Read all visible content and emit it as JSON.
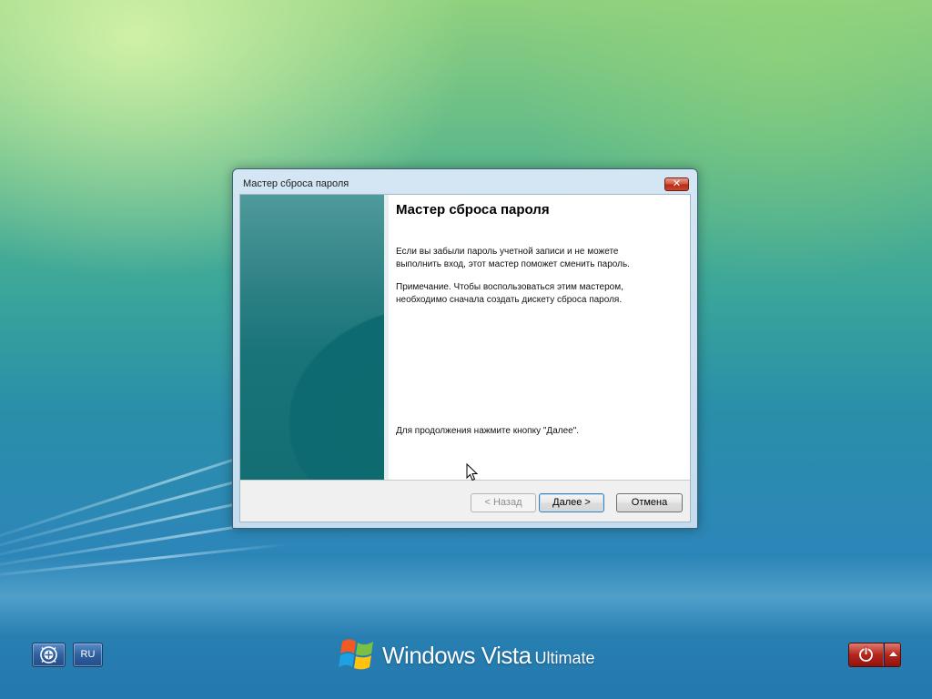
{
  "dialog": {
    "title": "Мастер сброса пароля",
    "close_icon": "close-icon",
    "heading": "Мастер сброса пароля",
    "intro_lines": [
      "Если вы забыли пароль учетной записи и не можете",
      "выполнить вход, этот мастер поможет сменить пароль."
    ],
    "note_lines": [
      "Примечание. Чтобы воспользоваться этим мастером,",
      "необходимо сначала создать дискету сброса пароля."
    ],
    "continue_text": "Для продолжения нажмите кнопку \"Далее\".",
    "buttons": {
      "back": "< Назад",
      "next": "Далее >",
      "cancel": "Отмена"
    }
  },
  "bottom_bar": {
    "ease_of_access_icon": "ease-of-access-icon",
    "language": "RU",
    "logo_brand": "Windows Vista",
    "logo_edition": "Ultimate",
    "power_icon": "power-icon",
    "power_options_icon": "chevron-up-icon"
  },
  "colors": {
    "close_red": "#c8472d",
    "power_red": "#b4261c",
    "teal_panel": "#136e74"
  }
}
